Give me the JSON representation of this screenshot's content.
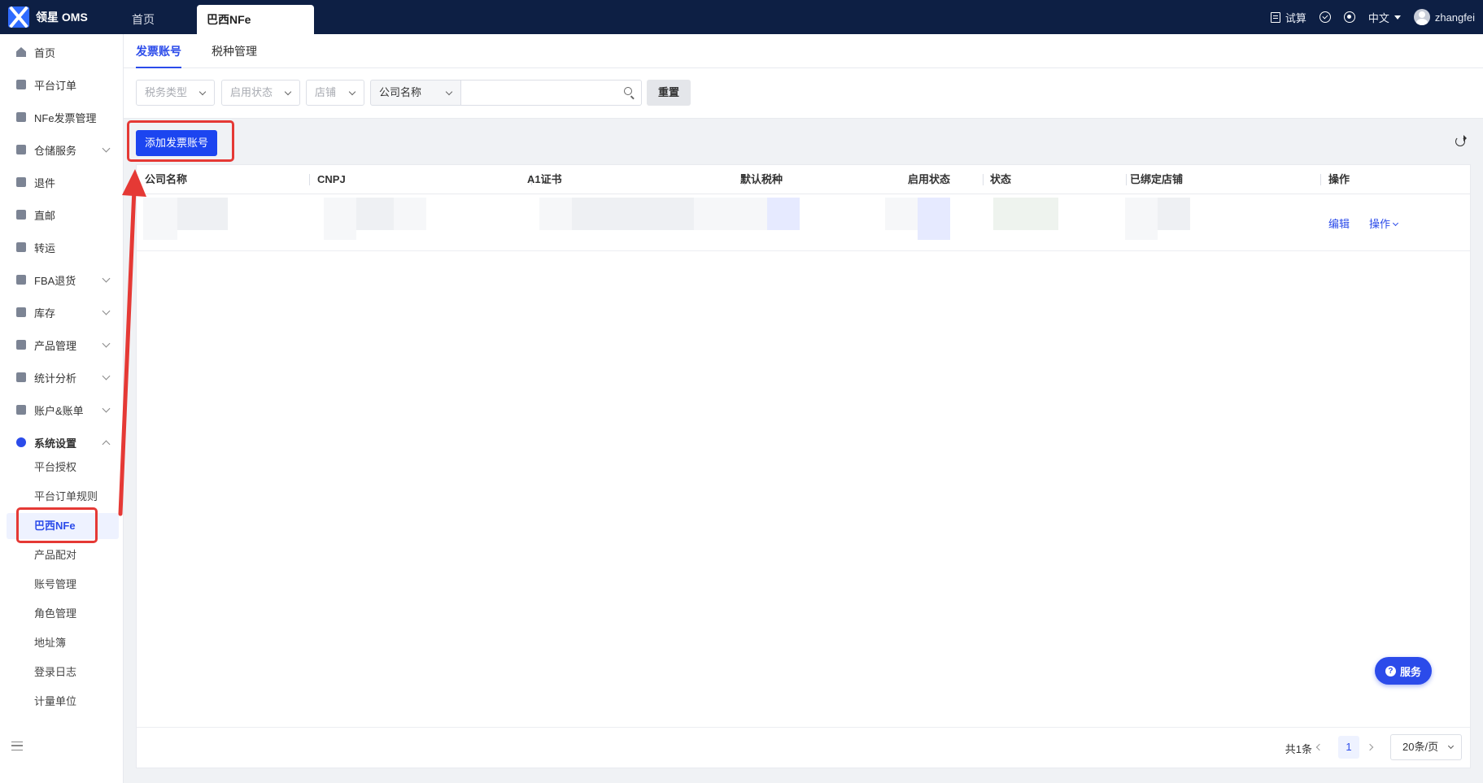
{
  "app": {
    "logo_text": "领星 OMS"
  },
  "topbar": {
    "tabs": [
      {
        "label": "首页"
      },
      {
        "label": "巴西NFe",
        "active": true
      }
    ],
    "calc_label": "试算",
    "language": "中文",
    "username": "zhangfei"
  },
  "sidebar": {
    "items": [
      {
        "label": "首页",
        "icon": "home-icon"
      },
      {
        "label": "平台订单",
        "icon": "document-icon"
      },
      {
        "label": "NFe发票管理",
        "icon": "document-icon"
      },
      {
        "label": "仓储服务",
        "icon": "warehouse-icon",
        "expandable": true
      },
      {
        "label": "退件",
        "icon": "return-icon"
      },
      {
        "label": "直邮",
        "icon": "mail-icon"
      },
      {
        "label": "转运",
        "icon": "transfer-icon"
      },
      {
        "label": "FBA退货",
        "icon": "amazon-icon",
        "expandable": true
      },
      {
        "label": "库存",
        "icon": "inventory-icon",
        "expandable": true
      },
      {
        "label": "产品管理",
        "icon": "product-icon",
        "expandable": true
      },
      {
        "label": "统计分析",
        "icon": "chart-icon",
        "expandable": true
      },
      {
        "label": "账户&账单",
        "icon": "wallet-icon",
        "expandable": true
      },
      {
        "label": "系统设置",
        "icon": "settings-icon",
        "expanded": true
      }
    ],
    "sub_items": [
      {
        "label": "平台授权"
      },
      {
        "label": "平台订单规则"
      },
      {
        "label": "巴西NFe",
        "active": true
      },
      {
        "label": "产品配对"
      },
      {
        "label": "账号管理"
      },
      {
        "label": "角色管理"
      },
      {
        "label": "地址簿"
      },
      {
        "label": "登录日志"
      },
      {
        "label": "计量单位"
      }
    ]
  },
  "subtabs": [
    {
      "label": "发票账号",
      "active": true
    },
    {
      "label": "税种管理"
    }
  ],
  "filters": {
    "tax_type": "税务类型",
    "enable_status": "启用状态",
    "store": "店铺",
    "search_field": "公司名称",
    "search_value": "",
    "reset_label": "重置"
  },
  "actions": {
    "add_label": "添加发票账号"
  },
  "table": {
    "columns": [
      "公司名称",
      "CNPJ",
      "A1证书",
      "默认税种",
      "启用状态",
      "状态",
      "已绑定店铺",
      "操作"
    ],
    "row_actions": {
      "edit": "编辑",
      "more": "操作"
    }
  },
  "pagination": {
    "total_text": "共1条",
    "current_page": "1",
    "page_size": "20条/页"
  },
  "service_button": {
    "label": "服务"
  },
  "colors": {
    "topbar": "#0d1f44",
    "primary": "#1c45f0",
    "annotation": "#e53935"
  }
}
